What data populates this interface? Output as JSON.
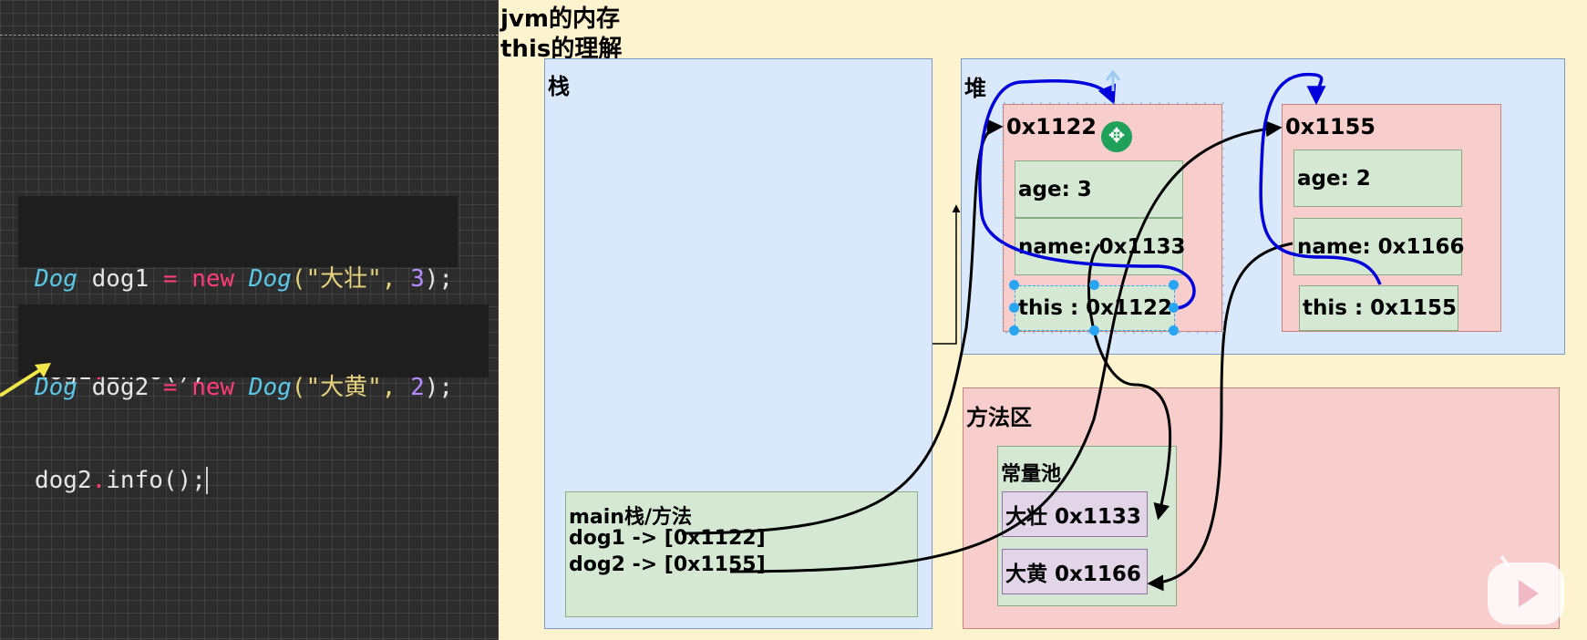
{
  "code": {
    "block1": {
      "line1": {
        "t1": "Dog",
        "t2": " dog1 ",
        "t3": "=",
        "t4": " ",
        "t5": "new",
        "t6": " ",
        "t7": "Dog",
        "t8": "(\"",
        "t9": "大壮",
        "t10": "\", ",
        "t11": "3",
        "t12": ");"
      },
      "line2": {
        "t1": "dog1",
        "t2": ".",
        "t3": "info();"
      }
    },
    "block2": {
      "line1": {
        "t1": "Dog",
        "t2": " dog2 ",
        "t3": "=",
        "t4": " ",
        "t5": "new",
        "t6": " ",
        "t7": "Dog",
        "t8": "(\"",
        "t9": "大黄",
        "t10": "\", ",
        "t11": "2",
        "t12": ");"
      },
      "line2": {
        "t1": "dog2",
        "t2": ".",
        "t3": "info();"
      }
    }
  },
  "diagram": {
    "title1": "jvm的内存",
    "title2": "this的理解",
    "stack": {
      "label": "栈",
      "frame": {
        "title": "main栈/方法",
        "line1": "dog1 -> [0x1122]",
        "line2": "dog2 -> [0x1155]"
      }
    },
    "heap": {
      "label": "堆",
      "obj1": {
        "addr": "0x1122",
        "age": "age: 3",
        "name": "name: 0x1133",
        "this": "this : 0x1122"
      },
      "obj2": {
        "addr": "0x1155",
        "age": "age: 2",
        "name": "name: 0x1166",
        "this": "this : 0x1155"
      }
    },
    "method_area": {
      "label": "方法区",
      "pool": {
        "label": "常量池",
        "s1": "大壮 0x1133",
        "s2": "大黄 0x1166"
      }
    }
  },
  "colors": {
    "stack": "#dae8fc",
    "heap_obj": "#f8cecc",
    "field": "#d5e8d4",
    "string": "#e1d5e7",
    "this_arrow": "#0000dd",
    "ref_arrow": "#000000"
  }
}
